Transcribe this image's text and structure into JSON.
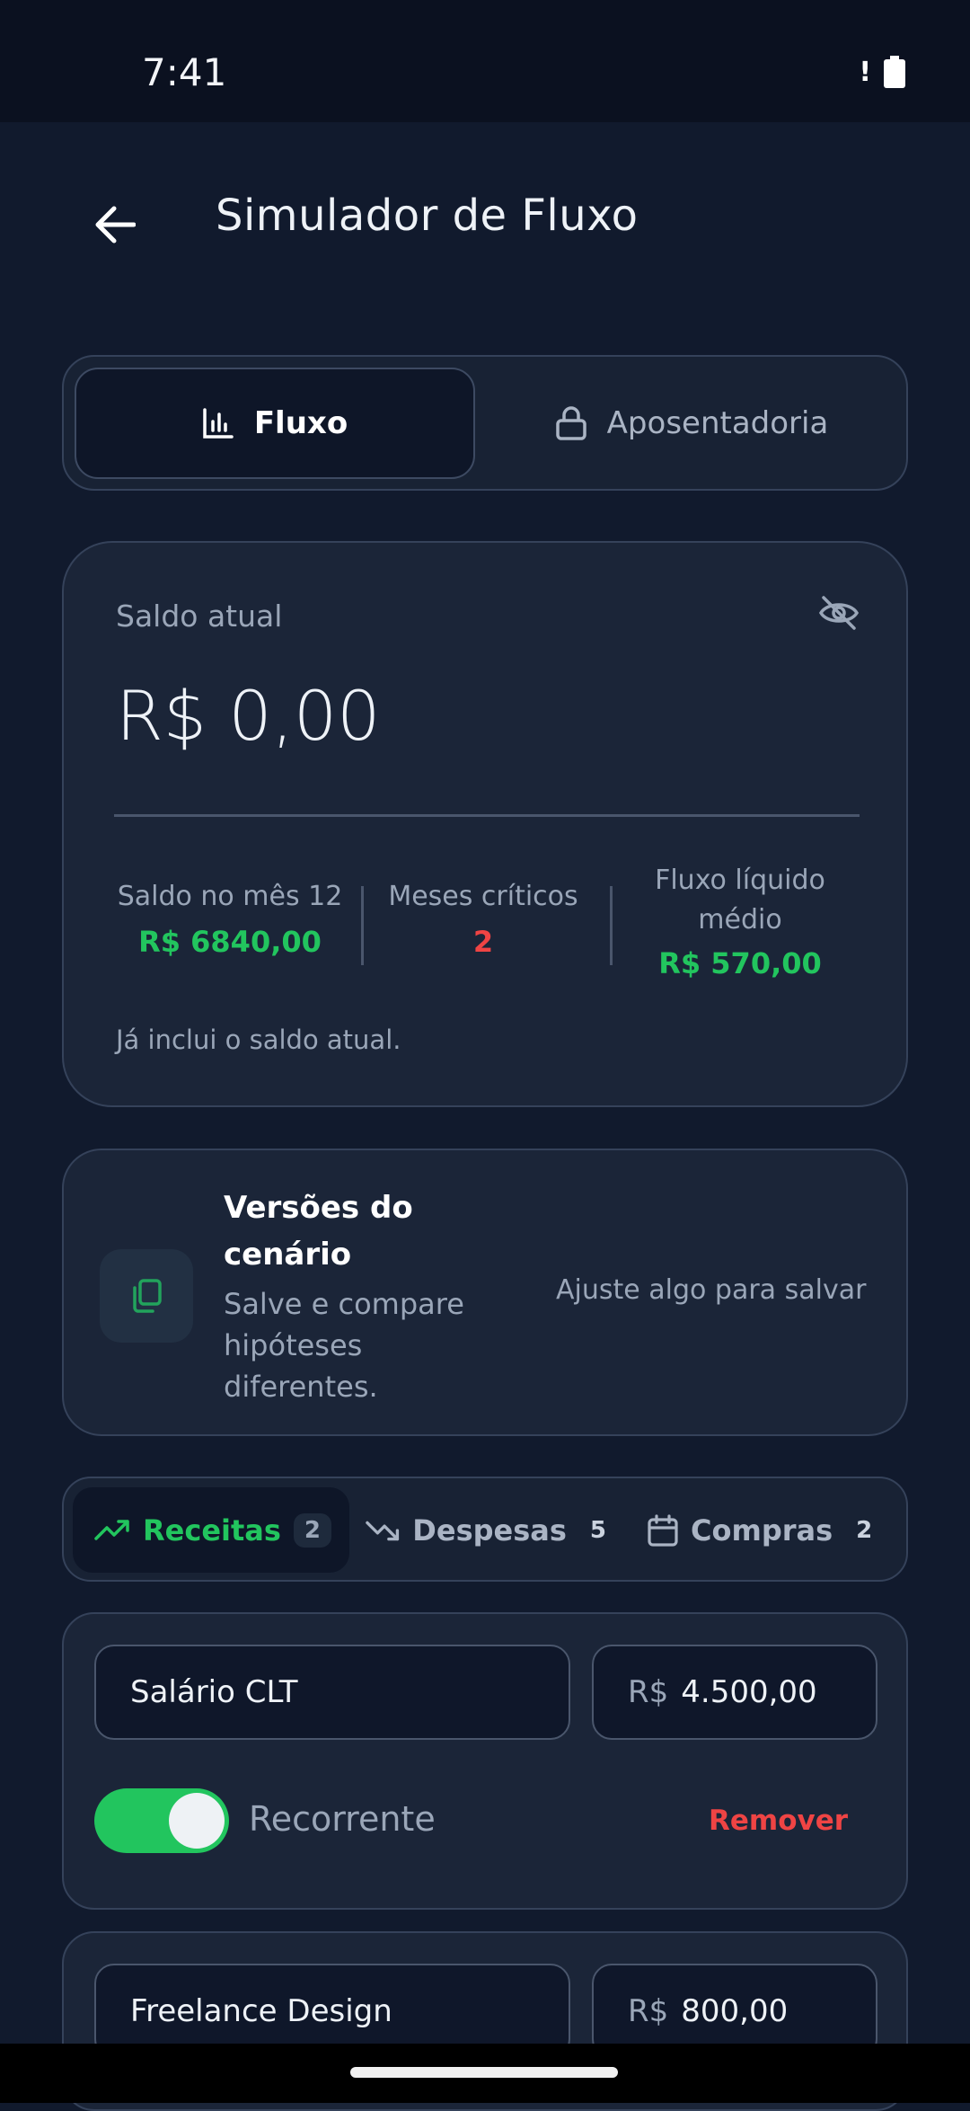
{
  "status_bar": {
    "time": "7:41",
    "alert": "!"
  },
  "header": {
    "title": "Simulador de Fluxo"
  },
  "mode_tabs": [
    {
      "label": "Fluxo",
      "icon": "bar-chart-icon",
      "active": true
    },
    {
      "label": "Aposentadoria",
      "icon": "lock-icon",
      "active": false
    }
  ],
  "balance": {
    "label": "Saldo atual",
    "value": "R$ 0,00",
    "stats": [
      {
        "label": "Saldo no mês 12",
        "value": "R$ 6840,00",
        "color": "#22c55e"
      },
      {
        "label": "Meses críticos",
        "value": "2",
        "color": "#ef4444"
      },
      {
        "label": "Fluxo líquido médio",
        "value": "R$ 570,00",
        "color": "#22c55e"
      }
    ],
    "note": "Já inclui o saldo atual."
  },
  "versions": {
    "title": "Versões do cenário",
    "description": "Salve e compare hipóteses diferentes.",
    "hint": "Ajuste algo para salvar"
  },
  "category_tabs": [
    {
      "label": "Receitas",
      "count": "2",
      "icon": "trending-up-icon"
    },
    {
      "label": "Despesas",
      "count": "5",
      "icon": "trending-down-icon"
    },
    {
      "label": "Compras",
      "count": "2",
      "icon": "calendar-icon"
    }
  ],
  "incomes": [
    {
      "name": "Salário CLT",
      "currency": "R$",
      "amount": "4.500,00",
      "recurring_label": "Recorrente",
      "recurring": true,
      "remove_label": "Remover"
    },
    {
      "name": "Freelance Design",
      "currency": "R$",
      "amount": "800,00"
    }
  ],
  "colors": {
    "positive": "#22c55e",
    "negative": "#ef4444",
    "background": "#111a2d"
  }
}
